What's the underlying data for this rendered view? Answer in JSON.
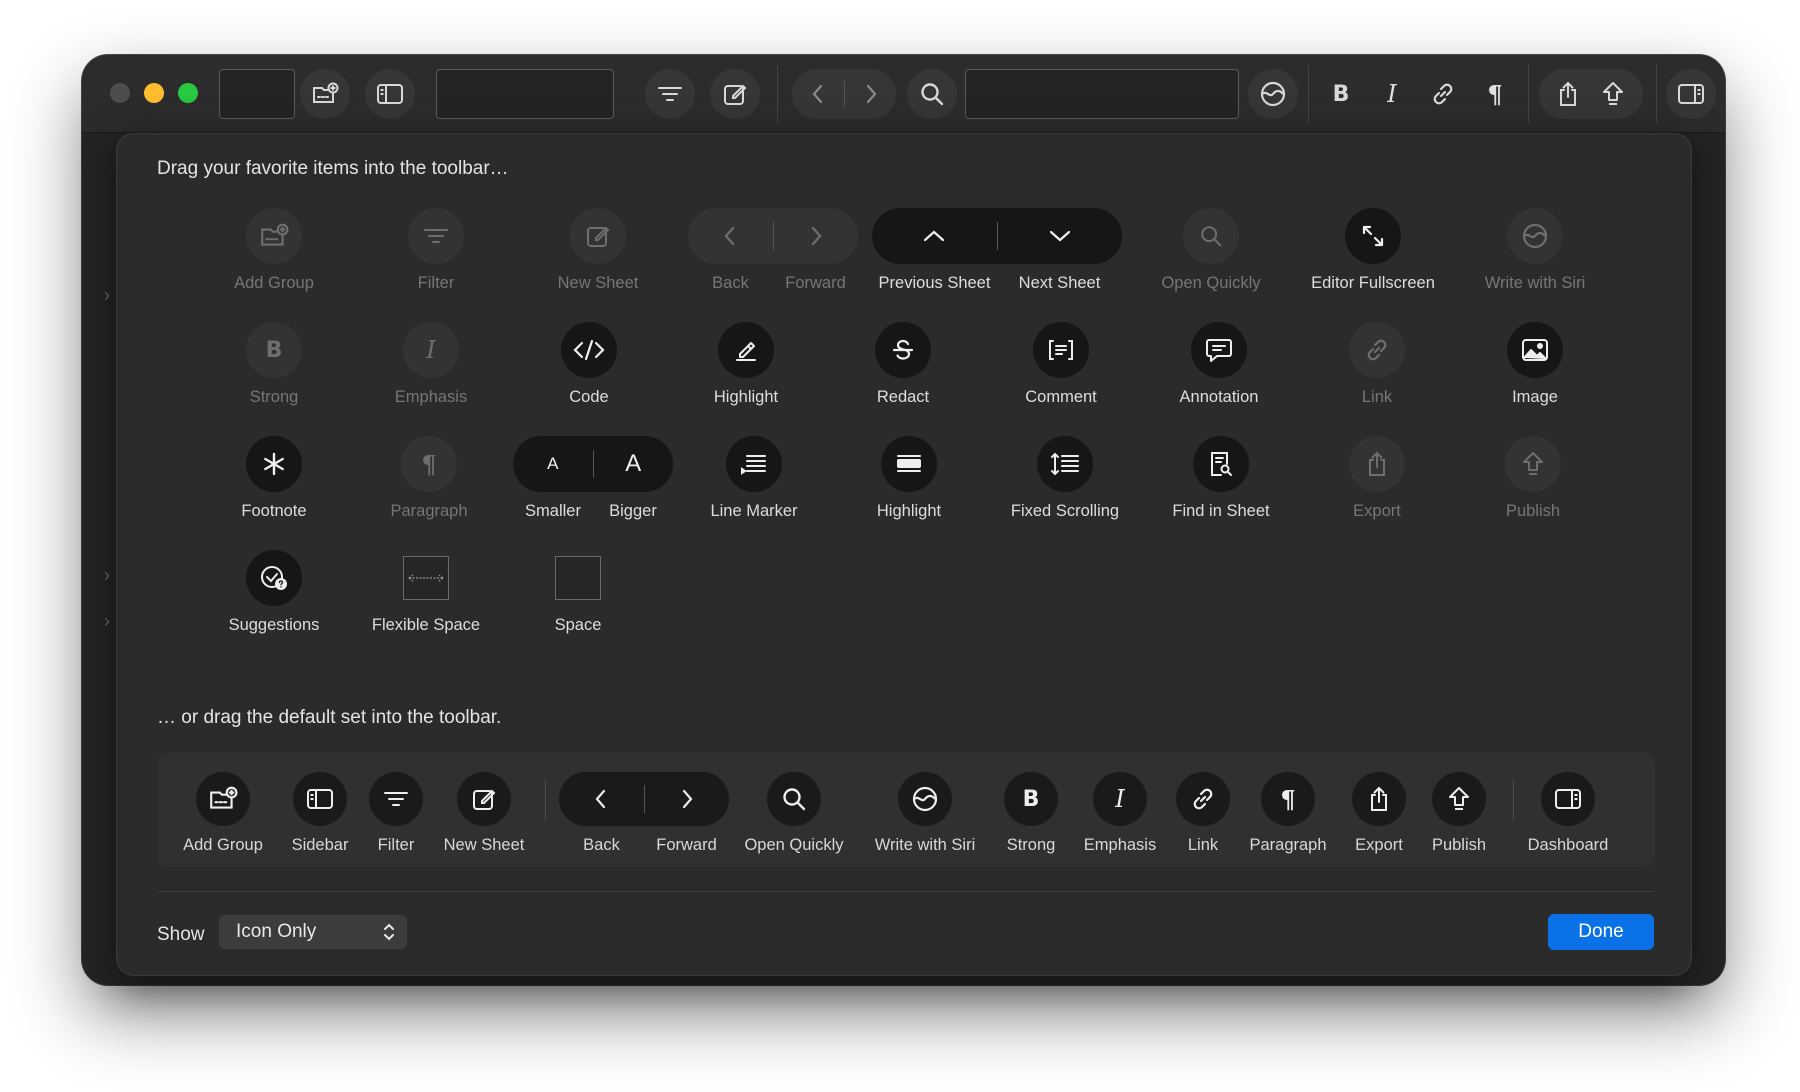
{
  "sheet": {
    "drag_title": "Drag your favorite items into the toolbar…",
    "default_title": "… or drag the default set into the toolbar.",
    "items": {
      "add_group": "Add Group",
      "filter": "Filter",
      "new_sheet": "New Sheet",
      "back": "Back",
      "forward": "Forward",
      "previous_sheet": "Previous Sheet",
      "next_sheet": "Next Sheet",
      "open_quickly": "Open Quickly",
      "editor_fullscreen": "Editor Fullscreen",
      "write_with_siri": "Write with Siri",
      "strong": "Strong",
      "emphasis": "Emphasis",
      "code": "Code",
      "highlight": "Highlight",
      "redact": "Redact",
      "comment": "Comment",
      "annotation": "Annotation",
      "link": "Link",
      "image": "Image",
      "footnote": "Footnote",
      "paragraph": "Paragraph",
      "smaller": "Smaller",
      "bigger": "Bigger",
      "line_marker": "Line Marker",
      "highlight2": "Highlight",
      "fixed_scrolling": "Fixed Scrolling",
      "find_in_sheet": "Find in Sheet",
      "export": "Export",
      "publish": "Publish",
      "suggestions": "Suggestions",
      "flexible_space": "Flexible Space",
      "space": "Space"
    },
    "glyphs": {
      "strong": "B",
      "emphasis": "I",
      "paragraph": "¶",
      "smaller": "A",
      "bigger": "A"
    },
    "default_set": {
      "add_group": "Add Group",
      "sidebar": "Sidebar",
      "filter": "Filter",
      "new_sheet": "New Sheet",
      "back": "Back",
      "forward": "Forward",
      "open_quickly": "Open Quickly",
      "write_with_siri": "Write with Siri",
      "strong": "Strong",
      "emphasis": "Emphasis",
      "link": "Link",
      "paragraph": "Paragraph",
      "export": "Export",
      "publish": "Publish",
      "dashboard": "Dashboard"
    },
    "show_label": "Show",
    "show_value": "Icon Only",
    "done_label": "Done"
  },
  "colors": {
    "accent": "#0a72e6",
    "traffic_close": "#4d4d4d",
    "traffic_minimize": "#febc2e",
    "traffic_zoom": "#28c840"
  }
}
